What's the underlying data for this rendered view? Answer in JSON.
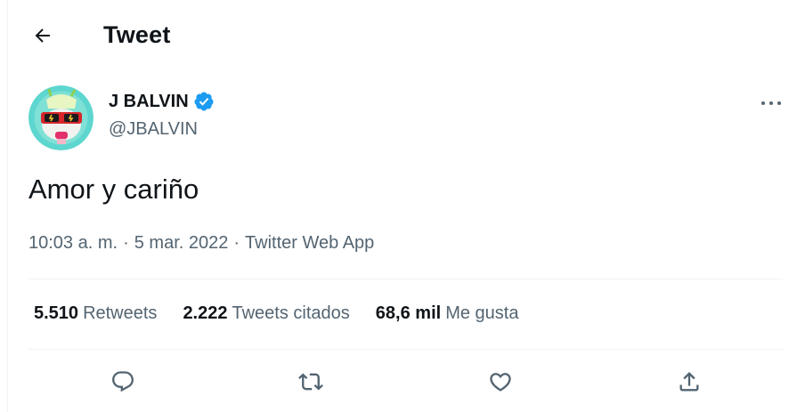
{
  "header": {
    "title": "Tweet"
  },
  "author": {
    "name": "J BALVIN",
    "handle": "@JBALVIN"
  },
  "tweet": {
    "text": "Amor y cariño",
    "time": "10:03 a. m.",
    "separator": "·",
    "date": "5 mar. 2022",
    "source": "Twitter Web App"
  },
  "stats": {
    "retweets": {
      "count": "5.510",
      "label": "Retweets"
    },
    "quotes": {
      "count": "2.222",
      "label": "Tweets citados"
    },
    "likes": {
      "count": "68,6 mil",
      "label": "Me gusta"
    }
  },
  "icons": {
    "back": "arrow-left-icon",
    "verified": "verified-badge-icon",
    "more": "more-horizontal-icon",
    "reply": "reply-icon",
    "retweet": "retweet-icon",
    "like": "heart-icon",
    "share": "share-icon"
  },
  "colors": {
    "text": "#0f1419",
    "secondary": "#536471",
    "verified": "#1d9bf0",
    "divider": "#eff3f4"
  }
}
